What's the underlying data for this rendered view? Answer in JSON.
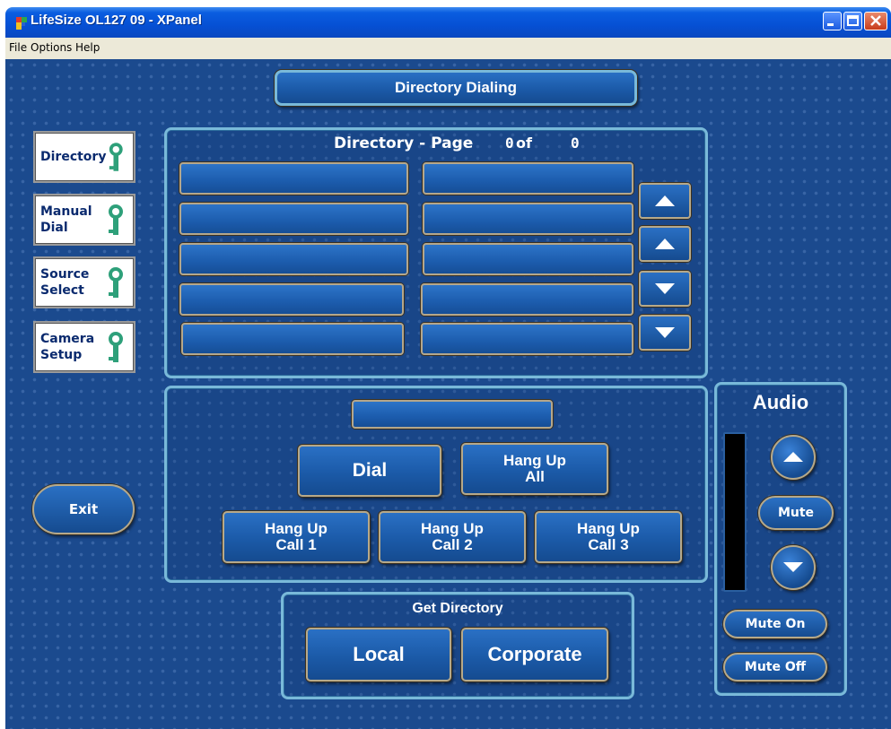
{
  "window": {
    "title": "LifeSize OL127 09 - XPanel"
  },
  "menu": {
    "items": [
      "File",
      "Options",
      "Help"
    ]
  },
  "header": {
    "title": "Directory Dialing"
  },
  "sidebar": {
    "items": [
      {
        "label": "Directory"
      },
      {
        "label": "Manual\nDial"
      },
      {
        "label": "Source\nSelect"
      },
      {
        "label": "Camera\nSetup"
      }
    ],
    "key_icon": "key-icon"
  },
  "directory": {
    "label": "Directory",
    "page_label": "- Page",
    "page_current": "0",
    "of_label": "of",
    "page_total": "0",
    "entries": [
      "",
      "",
      "",
      "",
      "",
      "",
      "",
      "",
      "",
      ""
    ]
  },
  "dial": {
    "number_display": "",
    "dial_label": "Dial",
    "hang_up_all_line1": "Hang Up",
    "hang_up_all_line2": "All",
    "hang_up_calls": [
      {
        "line1": "Hang Up",
        "line2": "Call 1"
      },
      {
        "line1": "Hang Up",
        "line2": "Call 2"
      },
      {
        "line1": "Hang Up",
        "line2": "Call 3"
      }
    ]
  },
  "get_directory": {
    "title": "Get Directory",
    "local_label": "Local",
    "corporate_label": "Corporate"
  },
  "audio": {
    "title": "Audio",
    "mute_label": "Mute",
    "mute_on_label": "Mute On",
    "mute_off_label": "Mute Off",
    "level": 0
  },
  "exit_label": "Exit",
  "colors": {
    "panel_bg": "#1b4a8e",
    "button_blue": "#1b5aa8",
    "frame": "#79b9d9",
    "key_green": "#2ea07a"
  }
}
